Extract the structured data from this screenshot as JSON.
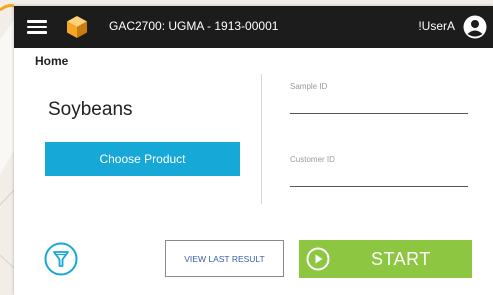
{
  "header": {
    "menu_icon": "hamburger-menu-icon",
    "logo_icon": "cube-logo-icon",
    "device_title": "GAC2700: UGMA - 1913-00001",
    "username": "!UserA",
    "user_icon": "user-circle-icon"
  },
  "breadcrumb": "Home",
  "product": {
    "name": "Soybeans",
    "choose_label": "Choose Product"
  },
  "form": {
    "sample_id_label": "Sample ID",
    "sample_id_value": "",
    "customer_id_label": "Customer ID",
    "customer_id_value": ""
  },
  "actions": {
    "filter_icon": "funnel-filter-icon",
    "view_last_label": "VIEW LAST RESULT",
    "start_label": "START",
    "start_icon": "play-circle-icon"
  },
  "colors": {
    "header_bg": "#1c1c1c",
    "logo_accent": "#f5a623",
    "choose_button": "#16a8d6",
    "start_button": "#8dc641",
    "filter_icon": "#16a8d6",
    "view_last_text": "#3a5fa8"
  }
}
